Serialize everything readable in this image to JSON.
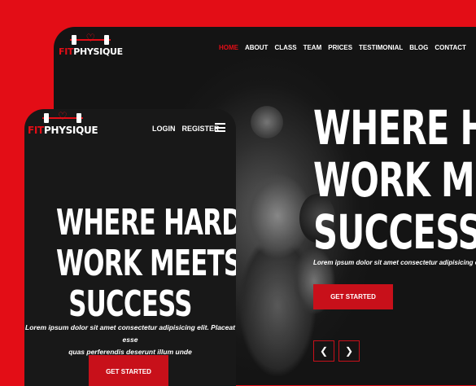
{
  "brand": {
    "fit": "FIT",
    "physique": "PHYSIQUE"
  },
  "desktop": {
    "nav": [
      "HOME",
      "ABOUT",
      "CLASS",
      "TEAM",
      "PRICES",
      "TESTIMONIAL",
      "BLOG",
      "CONTACT"
    ],
    "active_nav": "HOME",
    "hero_title_lines": [
      "WHERE HARD",
      "WORK MEETS",
      "SUCCESS"
    ],
    "hero_text": "Lorem ipsum dolor sit amet consectetur adipisicing elit. Placeat esse",
    "cta": "GET STARTED",
    "prev_icon": "chevron-left-icon",
    "next_icon": "chevron-right-icon"
  },
  "mobile": {
    "login": "LOGIN",
    "register": "REGISTER",
    "menu_icon": "hamburger-menu-icon",
    "hero_title_lines": [
      "WHERE HARD",
      "WORK MEETS",
      "SUCCESS"
    ],
    "hero_text_line1": "Lorem ipsum dolor sit amet consectetur adipisicing elit. Placeat esse",
    "hero_text_line2": "quas perferendis deserunt illum unde",
    "cta": "GET STARTED"
  },
  "colors": {
    "accent": "#e30d16",
    "background": "#141414",
    "text": "#ffffff"
  }
}
